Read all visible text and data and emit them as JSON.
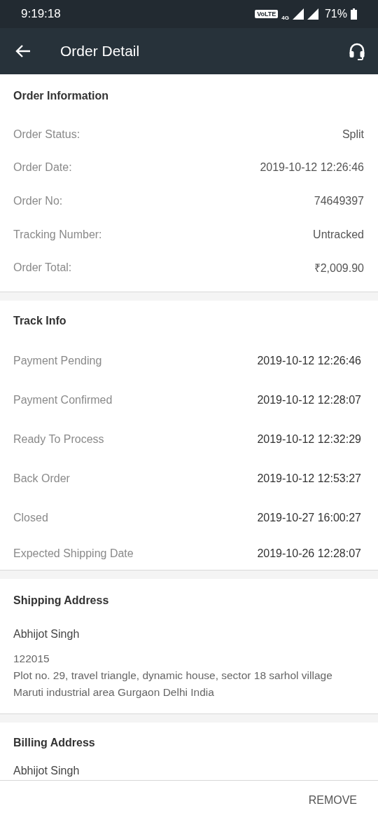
{
  "status_bar": {
    "time": "9:19:18",
    "volte": "VoLTE",
    "network": "4G",
    "battery": "71%"
  },
  "app_bar": {
    "title": "Order Detail"
  },
  "order_information": {
    "title": "Order Information",
    "rows": [
      {
        "label": "Order Status:",
        "value": "Split"
      },
      {
        "label": "Order Date:",
        "value": "2019-10-12 12:26:46"
      },
      {
        "label": "Order No:",
        "value": "74649397"
      },
      {
        "label": "Tracking Number:",
        "value": "Untracked"
      },
      {
        "label": "Order Total:",
        "value": "₹2,009.90"
      }
    ]
  },
  "track_info": {
    "title": "Track Info",
    "rows": [
      {
        "label": "Payment Pending",
        "value": "2019-10-12 12:26:46"
      },
      {
        "label": "Payment Confirmed",
        "value": "2019-10-12 12:28:07"
      },
      {
        "label": "Ready To Process",
        "value": "2019-10-12 12:32:29"
      },
      {
        "label": "Back Order",
        "value": "2019-10-12 12:53:27"
      },
      {
        "label": "Closed",
        "value": "2019-10-27 16:00:27"
      },
      {
        "label": "Expected Shipping Date",
        "value": "2019-10-26 12:28:07"
      }
    ]
  },
  "shipping_address": {
    "title": "Shipping Address",
    "name": "Abhijot Singh",
    "postcode": "122015",
    "address": "Plot no. 29, travel triangle, dynamic house, sector 18 sarhol village  Maruti industrial area Gurgaon Delhi India"
  },
  "billing_address": {
    "title": "Billing Address",
    "name": "Abhijot Singh"
  },
  "footer": {
    "button": "REMOVE"
  }
}
